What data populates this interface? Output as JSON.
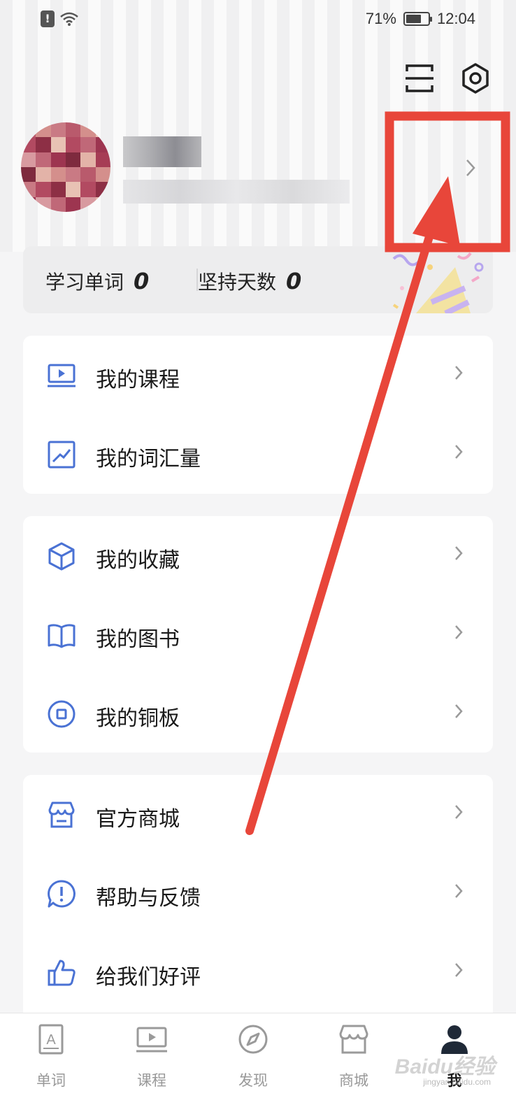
{
  "status_bar": {
    "battery_text": "71%",
    "battery_level": 0.71,
    "time": "12:04"
  },
  "header": {
    "scan_icon": "scan-icon",
    "settings_icon": "settings-hexagon-icon"
  },
  "profile": {
    "chevron": "›"
  },
  "stats": {
    "words_label": "学习单词",
    "words_value": "0",
    "days_label": "坚持天数",
    "days_value": "0"
  },
  "menu_groups": [
    {
      "items": [
        {
          "label": "我的课程",
          "icon": "course-video-icon"
        },
        {
          "label": "我的词汇量",
          "icon": "vocabulary-chart-icon"
        }
      ]
    },
    {
      "items": [
        {
          "label": "我的收藏",
          "icon": "box-icon"
        },
        {
          "label": "我的图书",
          "icon": "book-icon"
        },
        {
          "label": "我的铜板",
          "icon": "coin-icon"
        }
      ]
    },
    {
      "items": [
        {
          "label": "官方商城",
          "icon": "store-icon"
        },
        {
          "label": "帮助与反馈",
          "icon": "help-chat-icon"
        },
        {
          "label": "给我们好评",
          "icon": "thumbs-up-icon"
        }
      ]
    }
  ],
  "tabs": [
    {
      "label": "单词",
      "icon": "word-card-icon"
    },
    {
      "label": "课程",
      "icon": "course-icon"
    },
    {
      "label": "发现",
      "icon": "compass-icon"
    },
    {
      "label": "商城",
      "icon": "store-icon"
    },
    {
      "label": "我",
      "icon": "person-icon",
      "active": true
    }
  ],
  "watermark": {
    "text": "Baidu经验",
    "sub": "jingyan.baidu.com"
  },
  "colors": {
    "accent": "#4a72d4",
    "annotation_red": "#e8463a",
    "background": "#f5f5f6"
  }
}
